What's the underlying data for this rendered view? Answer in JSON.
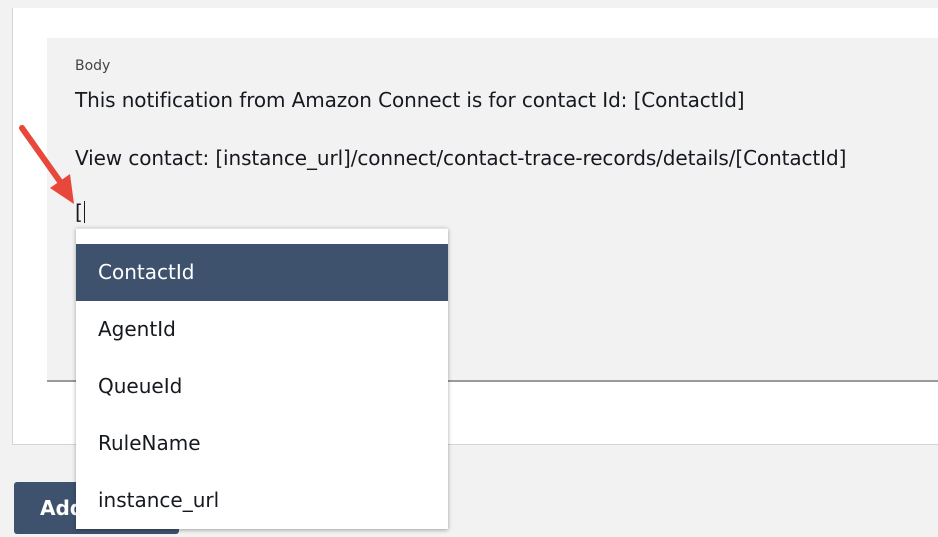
{
  "editor": {
    "label": "Body",
    "lines": [
      "This notification from Amazon Connect is for contact Id: [ContactId]",
      "View contact: [instance_url]/connect/contact-trace-records/details/[ContactId]",
      "["
    ]
  },
  "autocomplete": {
    "selected_index": 0,
    "items": [
      "ContactId",
      "AgentId",
      "QueueId",
      "RuleName",
      "instance_url"
    ]
  },
  "footer": {
    "add_button_label": "Add action"
  },
  "colors": {
    "selected_bg": "#3e526e",
    "arrow": "#e8473c"
  }
}
